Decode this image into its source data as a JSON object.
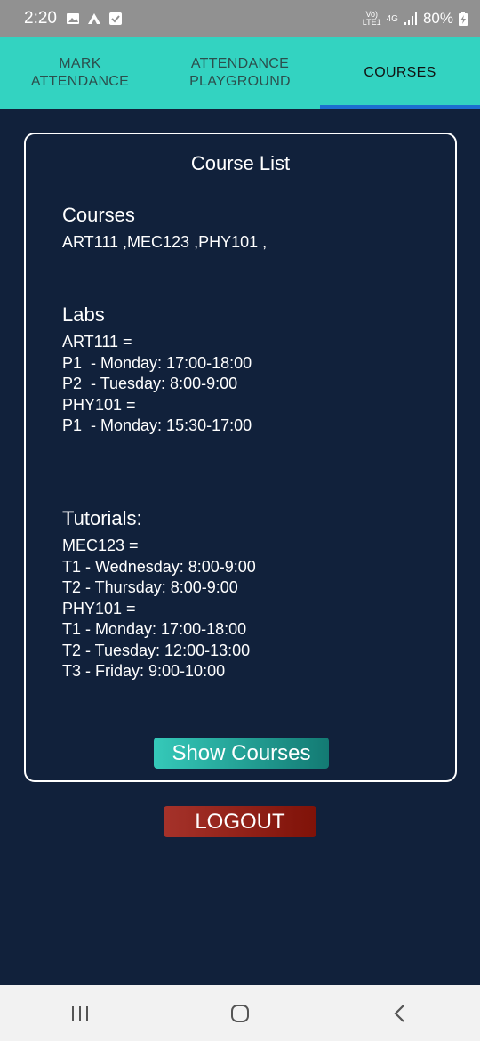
{
  "status_bar": {
    "time": "2:20",
    "network_top": "Vo)",
    "network_bottom": "LTE1",
    "network_type": "4G",
    "battery": "80%"
  },
  "tabs": [
    {
      "label_line1": "MARK",
      "label_line2": "ATTENDANCE",
      "active": false
    },
    {
      "label_line1": "ATTENDANCE",
      "label_line2": "PLAYGROUND",
      "active": false
    },
    {
      "label_line1": "COURSES",
      "label_line2": "",
      "active": true
    }
  ],
  "course_list": {
    "title": "Course List",
    "courses": {
      "heading": "Courses",
      "lines": [
        "ART111 ,MEC123 ,PHY101 ,"
      ]
    },
    "labs": {
      "heading": "Labs",
      "lines": [
        "ART111 =",
        "P1  - Monday: 17:00-18:00",
        "P2  - Tuesday: 8:00-9:00",
        "PHY101 =",
        "P1  - Monday: 15:30-17:00"
      ]
    },
    "tutorials": {
      "heading": "Tutorials:",
      "lines": [
        "MEC123 =",
        "T1 - Wednesday: 8:00-9:00",
        "T2 - Thursday: 8:00-9:00",
        "PHY101 =",
        "T1 - Monday: 17:00-18:00",
        "T2 - Tuesday: 12:00-13:00",
        "T3 - Friday: 9:00-10:00"
      ]
    },
    "show_button_label": "Show Courses"
  },
  "logout_button_label": "LOGOUT",
  "colors": {
    "background": "#11213b",
    "tab_bar": "#33d3c1",
    "tab_indicator": "#1d6fd0",
    "show_button": "#35c9b9",
    "logout_button": "#a5322a"
  },
  "icons": {
    "status": [
      "image-icon",
      "app-logo-icon",
      "checkbox-notification-icon",
      "signal-icon",
      "battery-charging-icon"
    ],
    "nav": [
      "recent-apps-icon",
      "home-icon",
      "back-icon"
    ]
  }
}
